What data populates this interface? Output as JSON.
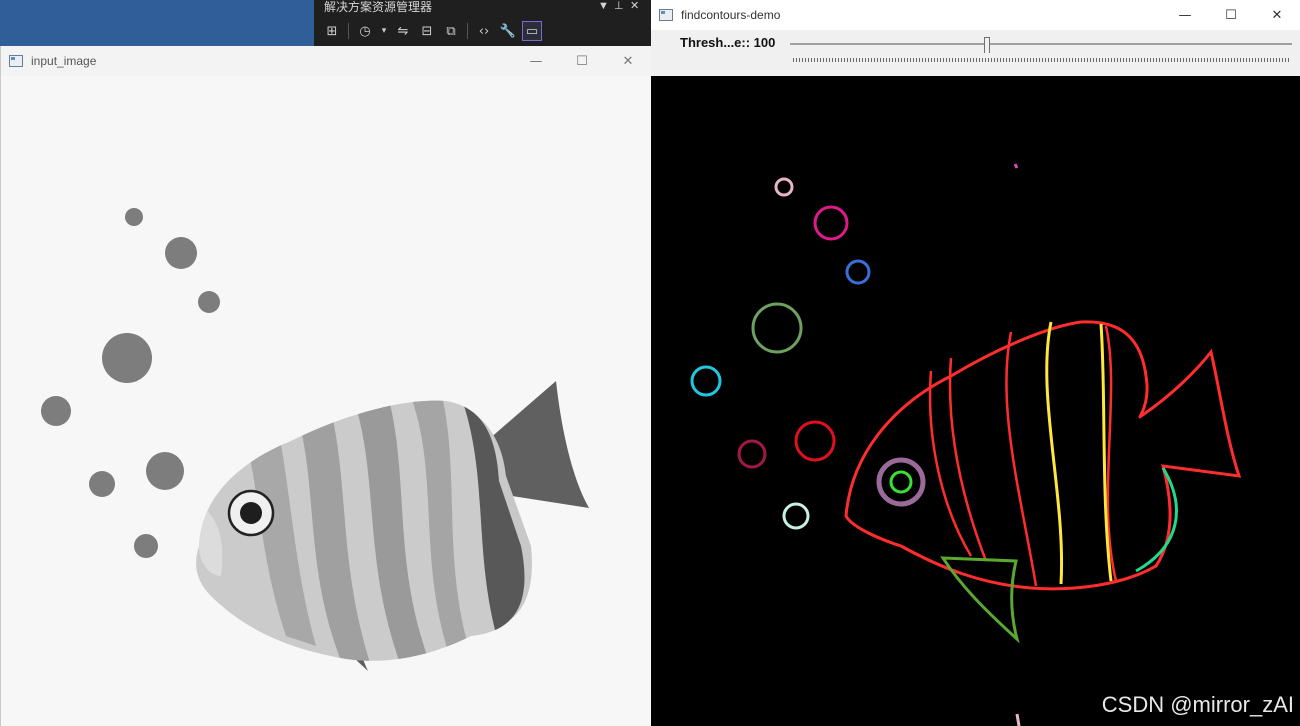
{
  "desktop": {
    "color": "#2f5e98"
  },
  "vs_panel": {
    "title": "解决方案资源管理器",
    "title_controls": [
      "▼",
      "⊥",
      "✕"
    ],
    "toolbar_icons": [
      "solution-icon",
      "history-icon",
      "dropdown-icon",
      "sync-icon",
      "collapse-icon",
      "copy-icon",
      "code-icon",
      "wrench-icon",
      "preview-icon"
    ]
  },
  "input_window": {
    "title": "input_image",
    "controls": {
      "minimize": "—",
      "maximize": "☐",
      "close": "✕"
    }
  },
  "contours_window": {
    "title": "findcontours-demo",
    "controls": {
      "minimize": "—",
      "maximize": "☐",
      "close": "✕"
    },
    "trackbar": {
      "label": "Thresh...e:: 100",
      "value": 100
    }
  },
  "colors": {
    "fish_outline": "#ff2d2d",
    "stripe_yellow": "#ffe83a",
    "tail_fin_green": "#5aa832",
    "fin_teal": "#22d98a",
    "eye_ring": "#9a6a9a",
    "eye_pupil": "#35e235"
  },
  "watermark": "CSDN @mirror_zAI"
}
